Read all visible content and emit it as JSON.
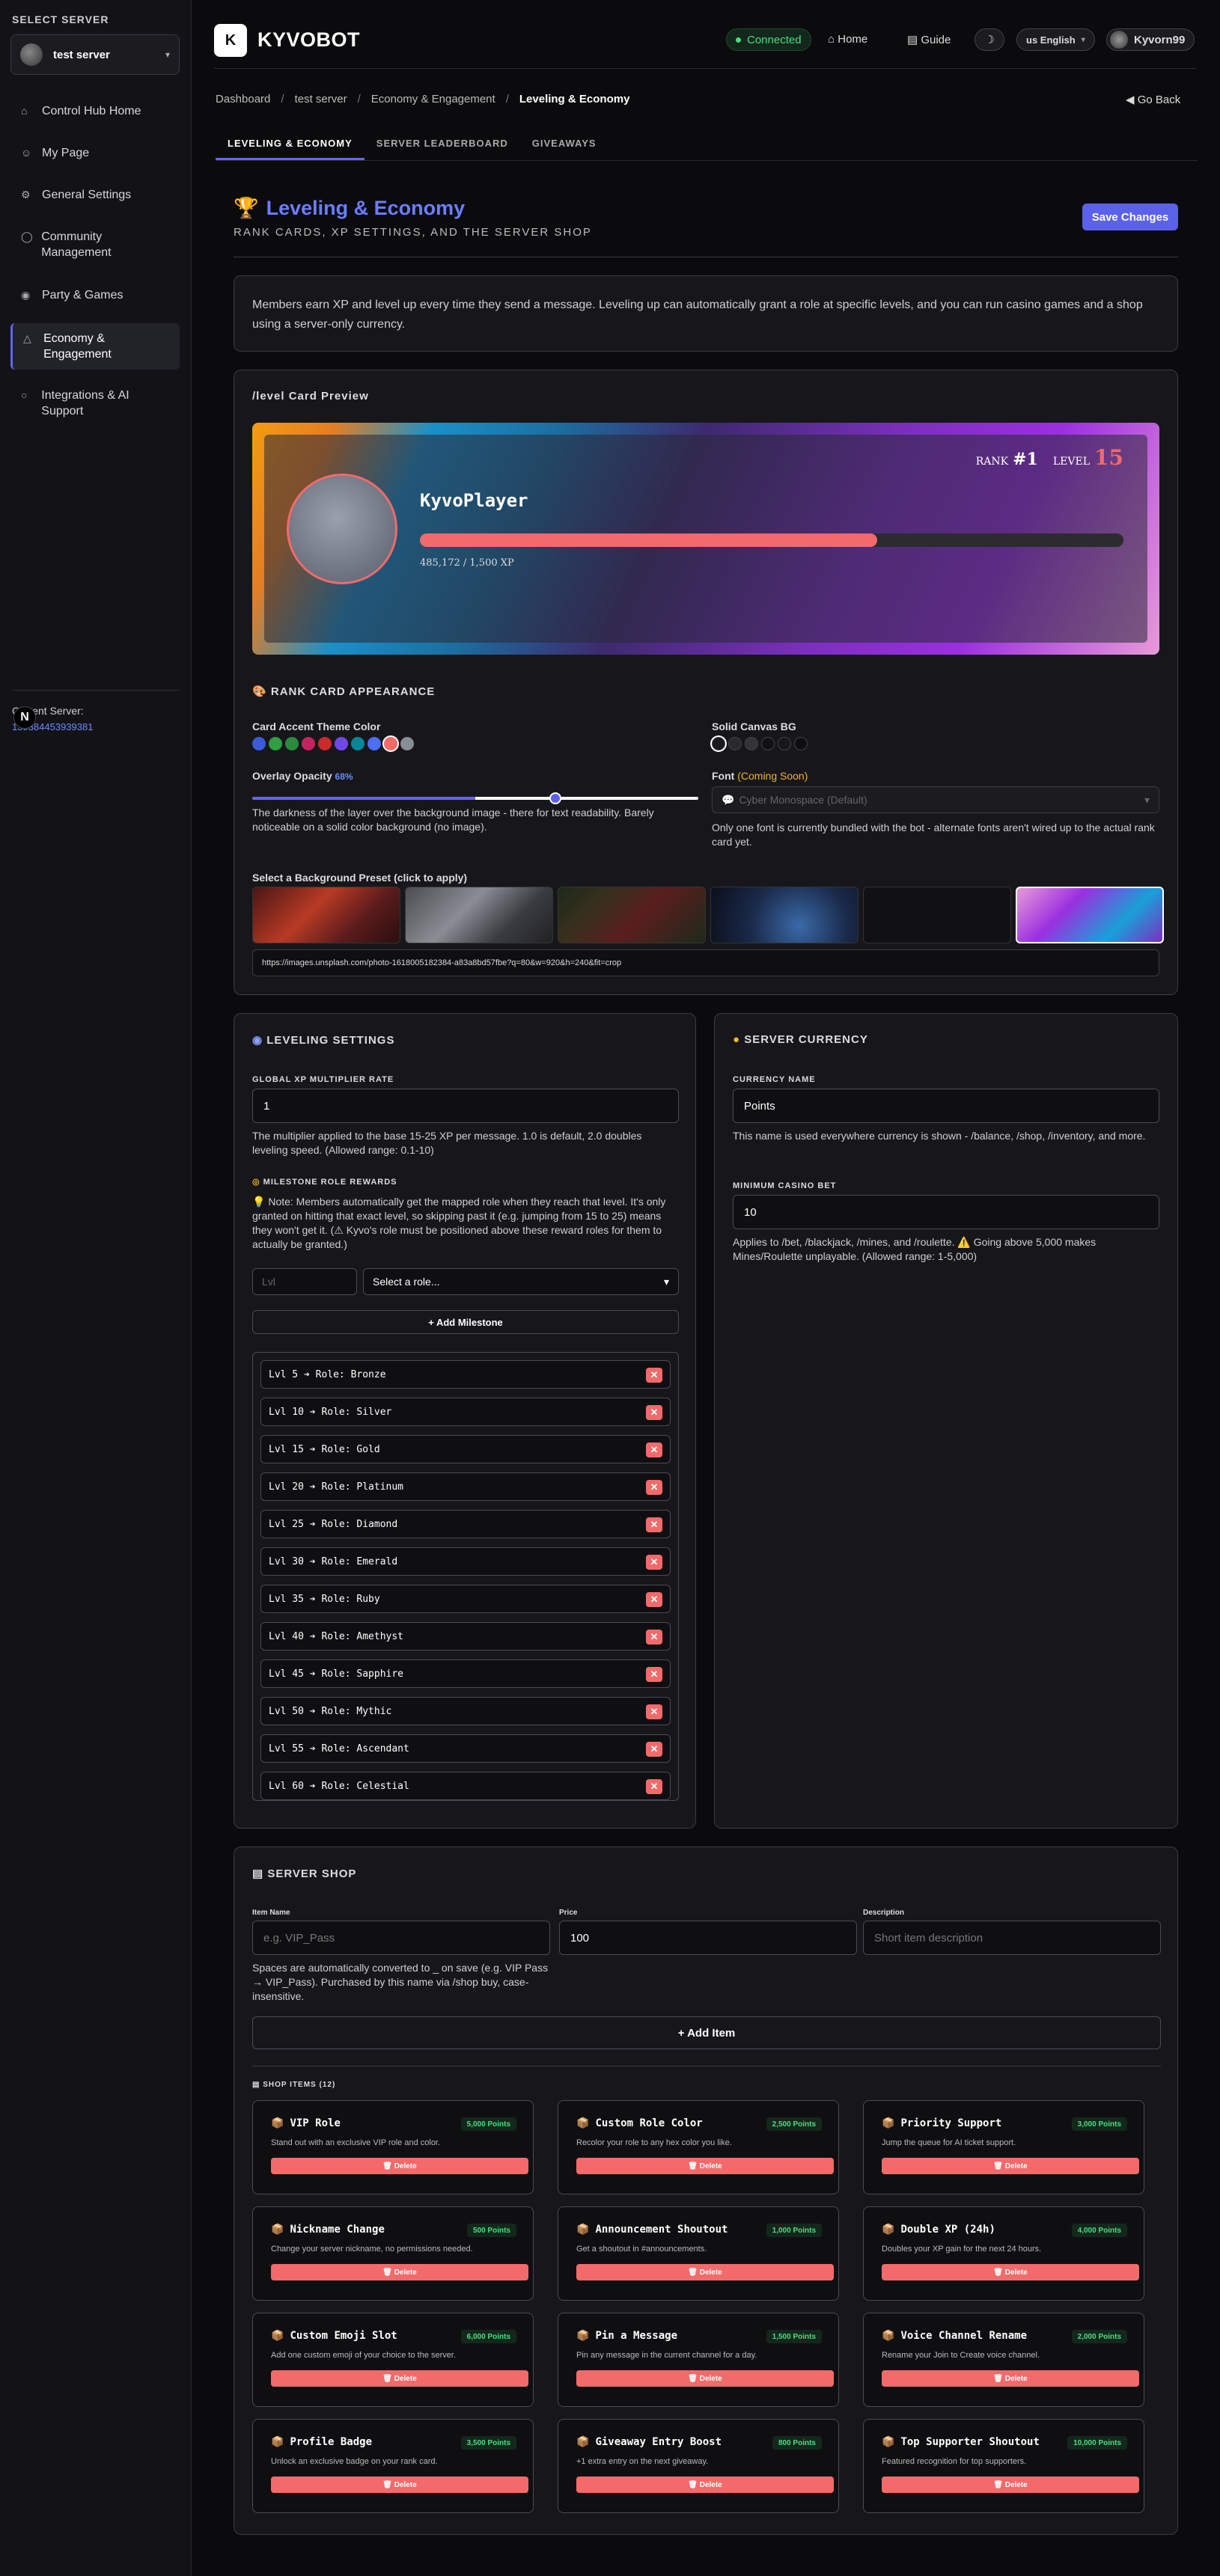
{
  "sidebar": {
    "select_label": "SELECT SERVER",
    "server_name": "test server",
    "items": [
      {
        "label": "Control Hub Home",
        "icon": "home-icon"
      },
      {
        "label": "My Page",
        "icon": "user-icon"
      },
      {
        "label": "General Settings",
        "icon": "gear-icon"
      },
      {
        "label": "Community Management",
        "icon": "shield-icon"
      },
      {
        "label": "Party & Games",
        "icon": "gamepad-icon"
      },
      {
        "label": "Economy & Engagement",
        "icon": "trophy-icon"
      },
      {
        "label": "Integrations & AI Support",
        "icon": "bulb-icon"
      }
    ],
    "current_label": "Current Server:",
    "current_id": "139384453939381",
    "badge": "N"
  },
  "topbar": {
    "brand": "KYVOBOT",
    "logo": "K",
    "status": "Connected",
    "home": "Home",
    "guide": "Guide",
    "theme_icon": "☽",
    "lang": "us English",
    "user": "Kyvorn99"
  },
  "breadcrumb": [
    "Dashboard",
    "test server",
    "Economy & Engagement",
    "Leveling & Economy"
  ],
  "go_back": "Go Back",
  "tabs": [
    "LEVELING & ECONOMY",
    "SERVER LEADERBOARD",
    "GIVEAWAYS"
  ],
  "page": {
    "title": "Leveling & Economy",
    "subtitle": "RANK CARDS, XP SETTINGS, AND THE SERVER SHOP",
    "save": "Save Changes",
    "intro": "Members earn XP and level up every time they send a message. Leveling up can automatically grant a role at specific levels, and you can run casino games and a shop using a server-only currency."
  },
  "preview": {
    "heading": "/level Card Preview",
    "name": "KyvoPlayer",
    "xp": "485,172 / 1,500 XP",
    "xp_fraction": 0.65,
    "rank_label": "RANK",
    "rank": "#1",
    "level_label": "LEVEL",
    "level": "15"
  },
  "appearance": {
    "heading": "RANK CARD APPEARANCE",
    "accent_label": "Card Accent Theme Color",
    "accent_colors": [
      "#3b5bdb",
      "#2f9e44",
      "#2b8a3e",
      "#c2255c",
      "#c92a2a",
      "#7048e8",
      "#0c8599",
      "#4c6ef5",
      "#f26a6a",
      "#868e96"
    ],
    "canvas_label": "Solid Canvas BG",
    "canvas_colors": [
      "#1a1a1e",
      "#2a2a2e",
      "#333338",
      "#111115",
      "#16161c",
      "#0e0e12"
    ],
    "opacity_label": "Overlay Opacity",
    "opacity_value": "68%",
    "opacity_fraction": 0.68,
    "opacity_help": "The darkness of the layer over the background image - there for text readability. Barely noticeable on a solid color background (no image).",
    "font_label": "Font",
    "font_soon": "(Coming Soon)",
    "font_value": "Cyber Monospace (Default)",
    "font_help": "Only one font is currently bundled with the bot - alternate fonts aren't wired up to the actual rank card yet.",
    "preset_label": "Select a Background Preset (click to apply)",
    "url": "https://images.unsplash.com/photo-1618005182384-a83a8bd57fbe?q=80&w=920&h=240&fit=crop"
  },
  "leveling": {
    "heading": "LEVELING SETTINGS",
    "mult_label": "GLOBAL XP MULTIPLIER RATE",
    "mult_value": "1",
    "mult_help": "The multiplier applied to the base 15-25 XP per message. 1.0 is default, 2.0 doubles leveling speed. (Allowed range: 0.1-10)",
    "milestone_label": "MILESTONE ROLE REWARDS",
    "milestone_note": "Note: Members automatically get the mapped role when they reach that level. It's only granted on hitting that exact level, so skipping past it (e.g. jumping from 15 to 25) means they won't get it. (⚠ Kyvo's role must be positioned above these reward roles for them to actually be granted.)",
    "lvl_placeholder": "Lvl",
    "role_placeholder": "Select a role...",
    "add_milestone": "+ Add Milestone",
    "milestones": [
      "Lvl 5 ➔ Role: Bronze",
      "Lvl 10 ➔ Role: Silver",
      "Lvl 15 ➔ Role: Gold",
      "Lvl 20 ➔ Role: Platinum",
      "Lvl 25 ➔ Role: Diamond",
      "Lvl 30 ➔ Role: Emerald",
      "Lvl 35 ➔ Role: Ruby",
      "Lvl 40 ➔ Role: Amethyst",
      "Lvl 45 ➔ Role: Sapphire",
      "Lvl 50 ➔ Role: Mythic",
      "Lvl 55 ➔ Role: Ascendant",
      "Lvl 60 ➔ Role: Celestial"
    ]
  },
  "currency": {
    "heading": "SERVER CURRENCY",
    "name_label": "CURRENCY NAME",
    "name_value": "Points",
    "name_help": "This name is used everywhere currency is shown - /balance, /shop, /inventory, and more.",
    "bet_label": "MINIMUM CASINO BET",
    "bet_value": "10",
    "bet_help": "Applies to /bet, /blackjack, /mines, and /roulette. ⚠️ Going above 5,000 makes Mines/Roulette unplayable. (Allowed range: 1-5,000)"
  },
  "shop": {
    "heading": "SERVER SHOP",
    "item_name_label": "Item Name",
    "item_name_placeholder": "e.g. VIP_Pass",
    "price_label": "Price",
    "price_value": "100",
    "desc_label": "Description",
    "desc_placeholder": "Short item description",
    "name_help": "Spaces are automatically converted to _ on save (e.g. VIP Pass → VIP_Pass). Purchased by this name via /shop buy, case-insensitive.",
    "add_item": "+ Add Item",
    "items_heading": "SHOP ITEMS (12)",
    "delete_label": "🗑 Delete",
    "items": [
      {
        "name": "VIP Role",
        "price": "5,000 Points",
        "desc": "Stand out with an exclusive VIP role and color."
      },
      {
        "name": "Custom Role Color",
        "price": "2,500 Points",
        "desc": "Recolor your role to any hex color you like."
      },
      {
        "name": "Priority Support",
        "price": "3,000 Points",
        "desc": "Jump the queue for AI ticket support."
      },
      {
        "name": "Nickname Change",
        "price": "500 Points",
        "desc": "Change your server nickname, no permissions needed."
      },
      {
        "name": "Announcement Shoutout",
        "price": "1,000 Points",
        "desc": "Get a shoutout in #announcements."
      },
      {
        "name": "Double XP (24h)",
        "price": "4,000 Points",
        "desc": "Doubles your XP gain for the next 24 hours."
      },
      {
        "name": "Custom Emoji Slot",
        "price": "6,000 Points",
        "desc": "Add one custom emoji of your choice to the server."
      },
      {
        "name": "Pin a Message",
        "price": "1,500 Points",
        "desc": "Pin any message in the current channel for a day."
      },
      {
        "name": "Voice Channel Rename",
        "price": "2,000 Points",
        "desc": "Rename your Join to Create voice channel."
      },
      {
        "name": "Profile Badge",
        "price": "3,500 Points",
        "desc": "Unlock an exclusive badge on your rank card."
      },
      {
        "name": "Giveaway Entry Boost",
        "price": "800 Points",
        "desc": "+1 extra entry on the next giveaway."
      },
      {
        "name": "Top Supporter Shoutout",
        "price": "10,000 Points",
        "desc": "Featured recognition for top supporters."
      }
    ]
  }
}
